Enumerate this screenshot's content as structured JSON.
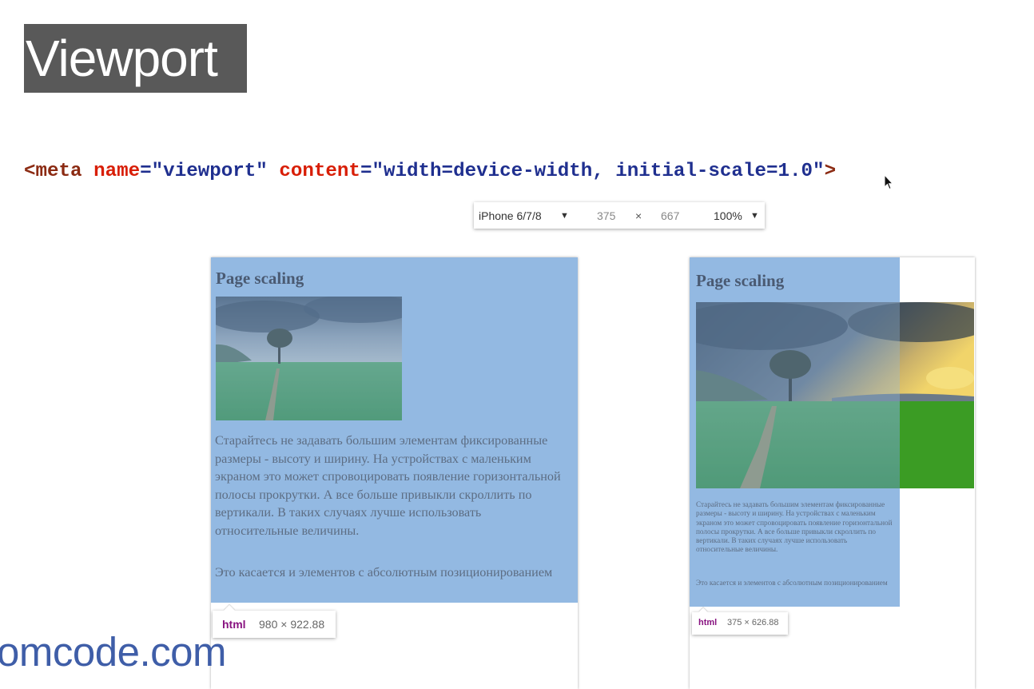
{
  "slide": {
    "title": "Viewport",
    "brand": "omcode.com"
  },
  "code": {
    "open": "<",
    "tag": "meta",
    "attr1": "name",
    "eq1": "=",
    "val1": "\"viewport\"",
    "attr2": "content",
    "eq2": "=",
    "val2": "\"width=device-width, initial-scale=1.0\"",
    "close": ">"
  },
  "device_toolbar": {
    "device": "iPhone 6/7/8",
    "width": "375",
    "times": "×",
    "height": "667",
    "zoom": "100%"
  },
  "left_preview": {
    "heading": "Page scaling",
    "paragraph1": "Старайтесь не задавать большим элементам фиксированные размеры - высоту и ширину. На устройствах с маленьким экраном это может спровоцировать появление горизонтальной полосы прокрутки. А все больше привыкли скроллить по вертикали. В таких случаях лучше использовать относительные величины.",
    "paragraph2": "Это касается и элементов с абсолютным позиционированием",
    "tooltip_tag": "html",
    "tooltip_size": "980 × 922.88"
  },
  "right_preview": {
    "heading": "Page scaling",
    "paragraph1": "Старайтесь не задавать большим элементам фиксированные размеры - высоту и ширину. На устройствах с маленьким экраном это может спровоцировать появление горизонтальной полосы прокрутки. А все больше привыкли скроллить по вертикали. В таких случаях лучше использовать относительные величины.",
    "paragraph2": "Это касается и элементов с абсолютным позиционированием",
    "tooltip_tag": "html",
    "tooltip_size": "375 × 626.88"
  },
  "colors": {
    "highlight": "#93b9e2",
    "code_tag": "#8b2a12",
    "code_attr": "#d81e06",
    "code_value": "#1f2f8f",
    "brand": "#3f5ea8"
  },
  "icons": [
    "dropdown-arrow-icon",
    "mouse-cursor-icon",
    "landscape-photo"
  ]
}
